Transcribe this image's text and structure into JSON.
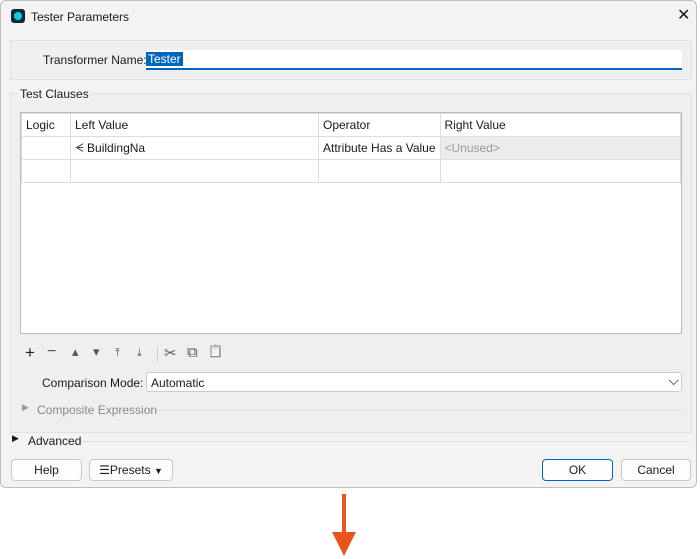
{
  "window": {
    "title": "Tester Parameters",
    "close_icon": "close-icon"
  },
  "transformer": {
    "label": "Transformer Name:",
    "value": "Tester"
  },
  "clauses": {
    "title": "Test Clauses",
    "headers": [
      "Logic",
      "Left Value",
      "Operator",
      "Right Value"
    ],
    "rows": [
      {
        "logic": "",
        "left": "BuildingNa",
        "operator": "Attribute Has a Value",
        "right": "<Unused>"
      },
      {
        "logic": "",
        "left": "",
        "operator": "",
        "right": ""
      }
    ]
  },
  "toolbar": {
    "add": "+",
    "remove": "−",
    "up": "▴",
    "down": "▾",
    "top": "⤒",
    "bottom": "⤓",
    "cut": "✂",
    "copy": "⧉",
    "paste": "📋"
  },
  "comparison": {
    "label": "Comparison Mode:",
    "value": "Automatic"
  },
  "composite": {
    "label": "Composite Expression"
  },
  "advanced": {
    "label": "Advanced"
  },
  "buttons": {
    "help": "Help",
    "presets": "Presets",
    "ok": "OK",
    "cancel": "Cancel"
  },
  "colors": {
    "accent": "#0067c0",
    "arrow": "#e8561f"
  }
}
